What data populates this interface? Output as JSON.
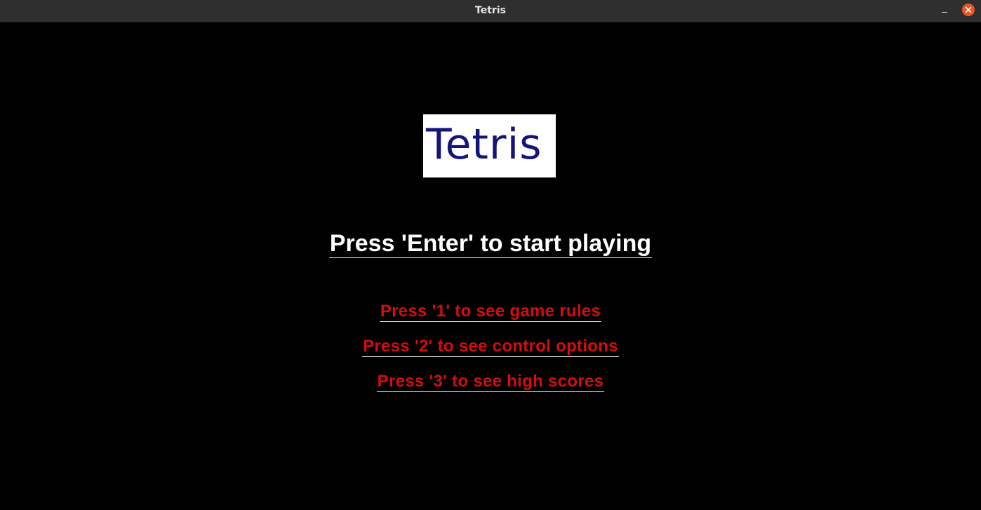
{
  "window": {
    "title": "Tetris"
  },
  "game": {
    "logo_text": "Tetris",
    "start_prompt": "Press 'Enter' to start playing",
    "menu": [
      {
        "label": "Press '1' to see game rules"
      },
      {
        "label": "Press '2' to see control options"
      },
      {
        "label": "Press '3' to see high scores"
      }
    ]
  },
  "colors": {
    "background": "#000000",
    "titlebar": "#2f2f2f",
    "logo_background": "#ffffff",
    "logo_text": "#14147a",
    "start_prompt": "#ffffff",
    "menu_text": "#d40d0d",
    "close_button": "#e95420"
  },
  "icons": {
    "minimize": "minimize-icon",
    "close": "close-icon"
  }
}
